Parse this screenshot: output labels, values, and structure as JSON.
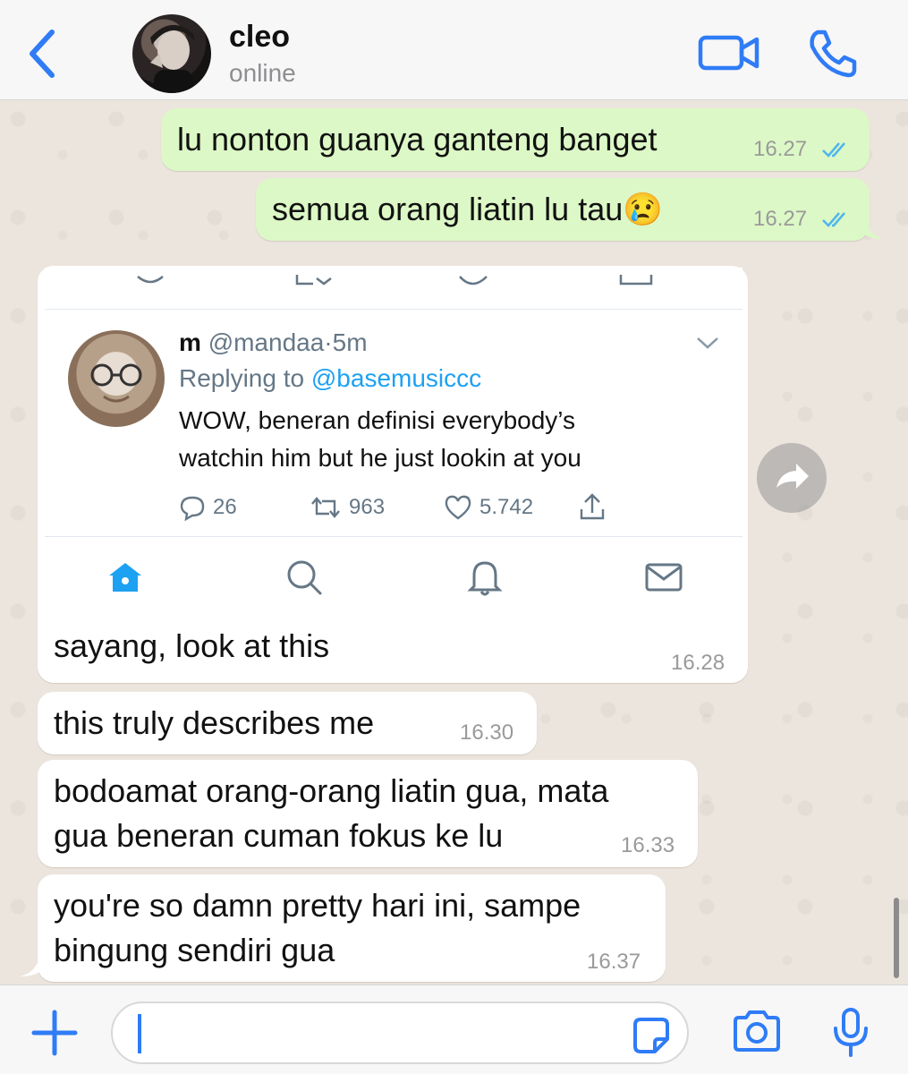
{
  "header": {
    "contact_name": "cleo",
    "status": "online"
  },
  "messages": [
    {
      "direction": "out",
      "text": "lu nonton guanya ganteng banget",
      "time": "16.27",
      "read": true
    },
    {
      "direction": "out",
      "text": "semua orang liatin lu tau😢",
      "time": "16.27",
      "read": true
    },
    {
      "direction": "in",
      "type": "image-with-caption",
      "text": "sayang, look at this",
      "time": "16.28"
    },
    {
      "direction": "in",
      "text": "this truly describes me",
      "time": "16.30"
    },
    {
      "direction": "in",
      "text": "bodoamat orang-orang liatin gua, mata\ngua beneran cuman fokus ke lu",
      "time": "16.33"
    },
    {
      "direction": "in",
      "text": "you're so damn pretty hari ini, sampe\nbingung sendiri gua",
      "time": "16.37"
    }
  ],
  "tweet": {
    "name": "m",
    "handle": "@mandaa",
    "separator": "·",
    "age": "5m",
    "replying_prefix": "Replying to",
    "replying_to": "@basemusiccc",
    "text": "WOW, beneran definisi everybody’s\nwatchin him but he just lookin at you",
    "replies": "26",
    "retweets": "963",
    "likes": "5.742"
  },
  "icons": {
    "back": "chevron-left-icon",
    "video": "video-camera-icon",
    "call": "phone-icon",
    "forward": "forward-arrow-icon",
    "plus": "plus-icon",
    "sticker": "sticker-icon",
    "camera": "camera-icon",
    "mic": "microphone-icon"
  },
  "colors": {
    "accent": "#2f7cf6",
    "outgoing_bubble": "#dcf8c6",
    "incoming_bubble": "#ffffff",
    "read_ticks": "#4fb6ec",
    "twitter_blue": "#1da1f2"
  }
}
